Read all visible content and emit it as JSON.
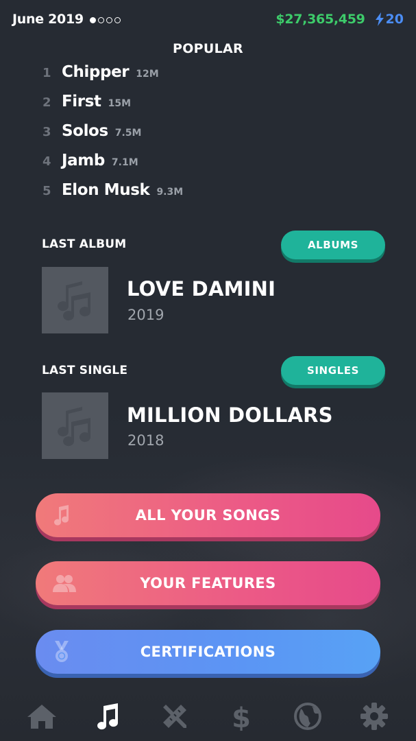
{
  "status": {
    "date": "June 2019",
    "money": "$27,365,459",
    "energy": "20"
  },
  "popular": {
    "title": "POPULAR",
    "items": [
      {
        "rank": "1",
        "name": "Chipper",
        "count": "12M"
      },
      {
        "rank": "2",
        "name": "First",
        "count": "15M"
      },
      {
        "rank": "3",
        "name": "Solos",
        "count": "7.5M"
      },
      {
        "rank": "4",
        "name": "Jamb",
        "count": "7.1M"
      },
      {
        "rank": "5",
        "name": "Elon Musk",
        "count": "9.3M"
      }
    ]
  },
  "last_album": {
    "label": "LAST ALBUM",
    "button": "ALBUMS",
    "title": "LOVE DAMINI",
    "year": "2019"
  },
  "last_single": {
    "label": "LAST SINGLE",
    "button": "SINGLES",
    "title": "MILLION DOLLARS",
    "year": "2018"
  },
  "buttons": {
    "songs": "ALL YOUR SONGS",
    "features": "YOUR FEATURES",
    "certifications": "CERTIFICATIONS"
  },
  "nav": [
    "home-icon",
    "music-note-icon",
    "pencil-ruler-icon",
    "dollar-icon",
    "globe-icon",
    "gear-icon"
  ],
  "colors": {
    "background": "#262b33",
    "money": "#3dcb6a",
    "energy": "#4b8df4",
    "teal_pill": "#1fb39a",
    "pink_button": "#ec5a86",
    "blue_button": "#5b95f4"
  }
}
